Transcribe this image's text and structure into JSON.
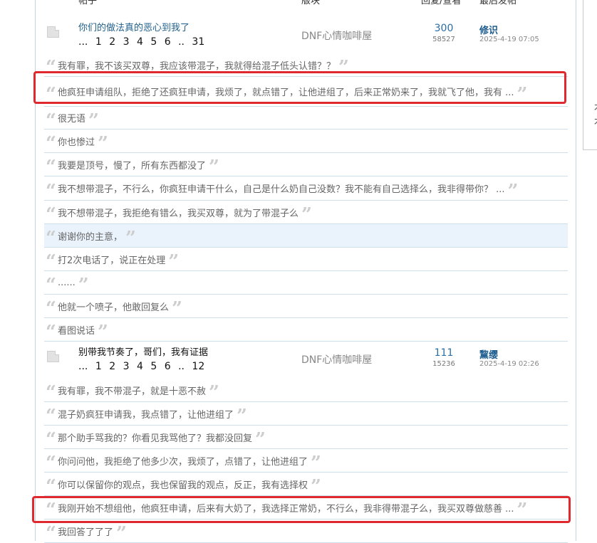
{
  "header": {
    "topic": "帖子",
    "forum": "版块",
    "replies": "回复/查看",
    "last": "最后发帖"
  },
  "threads": [
    {
      "title": "你们的做法真的恶心到我了",
      "title_color": "#1f5f8b",
      "pager": [
        "...",
        "1",
        "2",
        "3",
        "4",
        "5",
        "6",
        "..",
        "31"
      ],
      "forum": "DNF心情咖啡屋",
      "replies": "300",
      "views": "58527",
      "last_user": "修识",
      "last_time": "2025-4-19 07:05"
    },
    {
      "title": "别带我节奏了，哥们，我有证据",
      "title_color": "#111111",
      "pager": [
        "...",
        "1",
        "2",
        "3",
        "4",
        "5",
        "6",
        "..",
        "12"
      ],
      "forum": "DNF心情咖啡屋",
      "replies": "111",
      "views": "15236",
      "last_user": "黧缨",
      "last_time": "2025-4-19 02:26"
    }
  ],
  "thread1_replies": [
    "我有罪，我不该买双尊，我应该带混子，我就得给混子低头认错？？",
    "他疯狂申请组队，拒绝了还疯狂申请，我烦了，就点错了，让他进组了，后来正常奶来了，我就飞了他，我有 ...",
    "很无语",
    "你也惨过",
    "我要是顶号，慢了，所有东西都没了",
    "我不想带混子，不行么，你疯狂申请干什么，自己是什么奶自己没数？我不能有自己选择么，我非得带你？ ...",
    "我不想带混子，我拒绝有错么，我买双尊，就为了带混子么",
    "谢谢你的主意，",
    "打2次电话了，说正在处理",
    "......",
    "他就一个喷子，他敢回复么",
    "看图说话"
  ],
  "thread2_replies": [
    "我有罪，我不带混子，就是十恶不赦",
    "混子奶疯狂申请我，我点错了，让他进组了",
    "那个助手骂我的？你看见我骂他了？我都没回复",
    "你问问他，我拒绝了他多少次，我烦了，点错了，让他进组了",
    "你可以保留你的观点，我也保留我的观点，反正，我有选择权",
    "我刚开始不想组他，他疯狂申请，后来有大奶了，我选择正常奶，不行么，我非得带混子么，我买双尊做慈善 ...",
    "我回答了了了"
  ],
  "highlight_color": "#e0282f",
  "side": {
    "chars": [
      "木",
      "⽊"
    ]
  }
}
